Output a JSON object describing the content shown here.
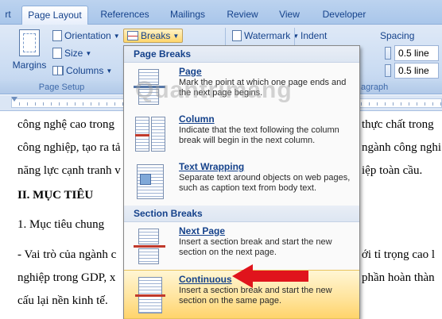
{
  "tabs": [
    {
      "label": "rt"
    },
    {
      "label": "Page Layout"
    },
    {
      "label": "References"
    },
    {
      "label": "Mailings"
    },
    {
      "label": "Review"
    },
    {
      "label": "View"
    },
    {
      "label": "Developer"
    }
  ],
  "ribbon": {
    "margins_label": "Margins",
    "orientation_label": "Orientation",
    "size_label": "Size",
    "columns_label": "Columns",
    "breaks_label": "Breaks",
    "watermark_label": "Watermark",
    "indent_label": "Indent",
    "spacing_label": "Spacing",
    "spacing_before": "0.5 line",
    "spacing_after": "0.5 line",
    "page_setup_group": "Page Setup",
    "paragraph_group": "agraph"
  },
  "document": {
    "lines": [
      {
        "left": "công nghệ cao trong",
        "right": "thực chất trong"
      },
      {
        "left": "công nghiệp, tạo ra tả",
        "right": "ngành công nghi"
      },
      {
        "left": "năng lực cạnh tranh v",
        "right": "iệp toàn cầu."
      },
      {
        "left": "II. MỤC TIÊU",
        "right": ""
      },
      {
        "left": "1. Mục tiêu chung",
        "right": ""
      },
      {
        "left": "- Vai trò của ngành c",
        "right": "ới tỉ trọng cao l"
      },
      {
        "left": "nghiệp trong GDP, x",
        "right": "phần hoàn thàn"
      },
      {
        "left": "cấu lại nền kinh tế.",
        "right": ""
      }
    ]
  },
  "breaks_menu": {
    "page_breaks_header": "Page Breaks",
    "section_breaks_header": "Section Breaks",
    "items": [
      {
        "title": "Page",
        "desc": "Mark the point at which one page ends and the next page begins."
      },
      {
        "title": "Column",
        "desc": "Indicate that the text following the column break will begin in the next column."
      },
      {
        "title": "Text Wrapping",
        "desc": "Separate text around objects on web pages, such as caption text from body text."
      },
      {
        "title": "Next Page",
        "desc": "Insert a section break and start the new section on the next page."
      },
      {
        "title": "Continuous",
        "desc": "Insert a section break and start the new section on the same page."
      }
    ]
  },
  "watermark_text": "Quantrimang",
  "colors": {
    "ribbon_text": "#15428b",
    "highlight": "#ffd46b",
    "arrow": "#e0141c"
  }
}
